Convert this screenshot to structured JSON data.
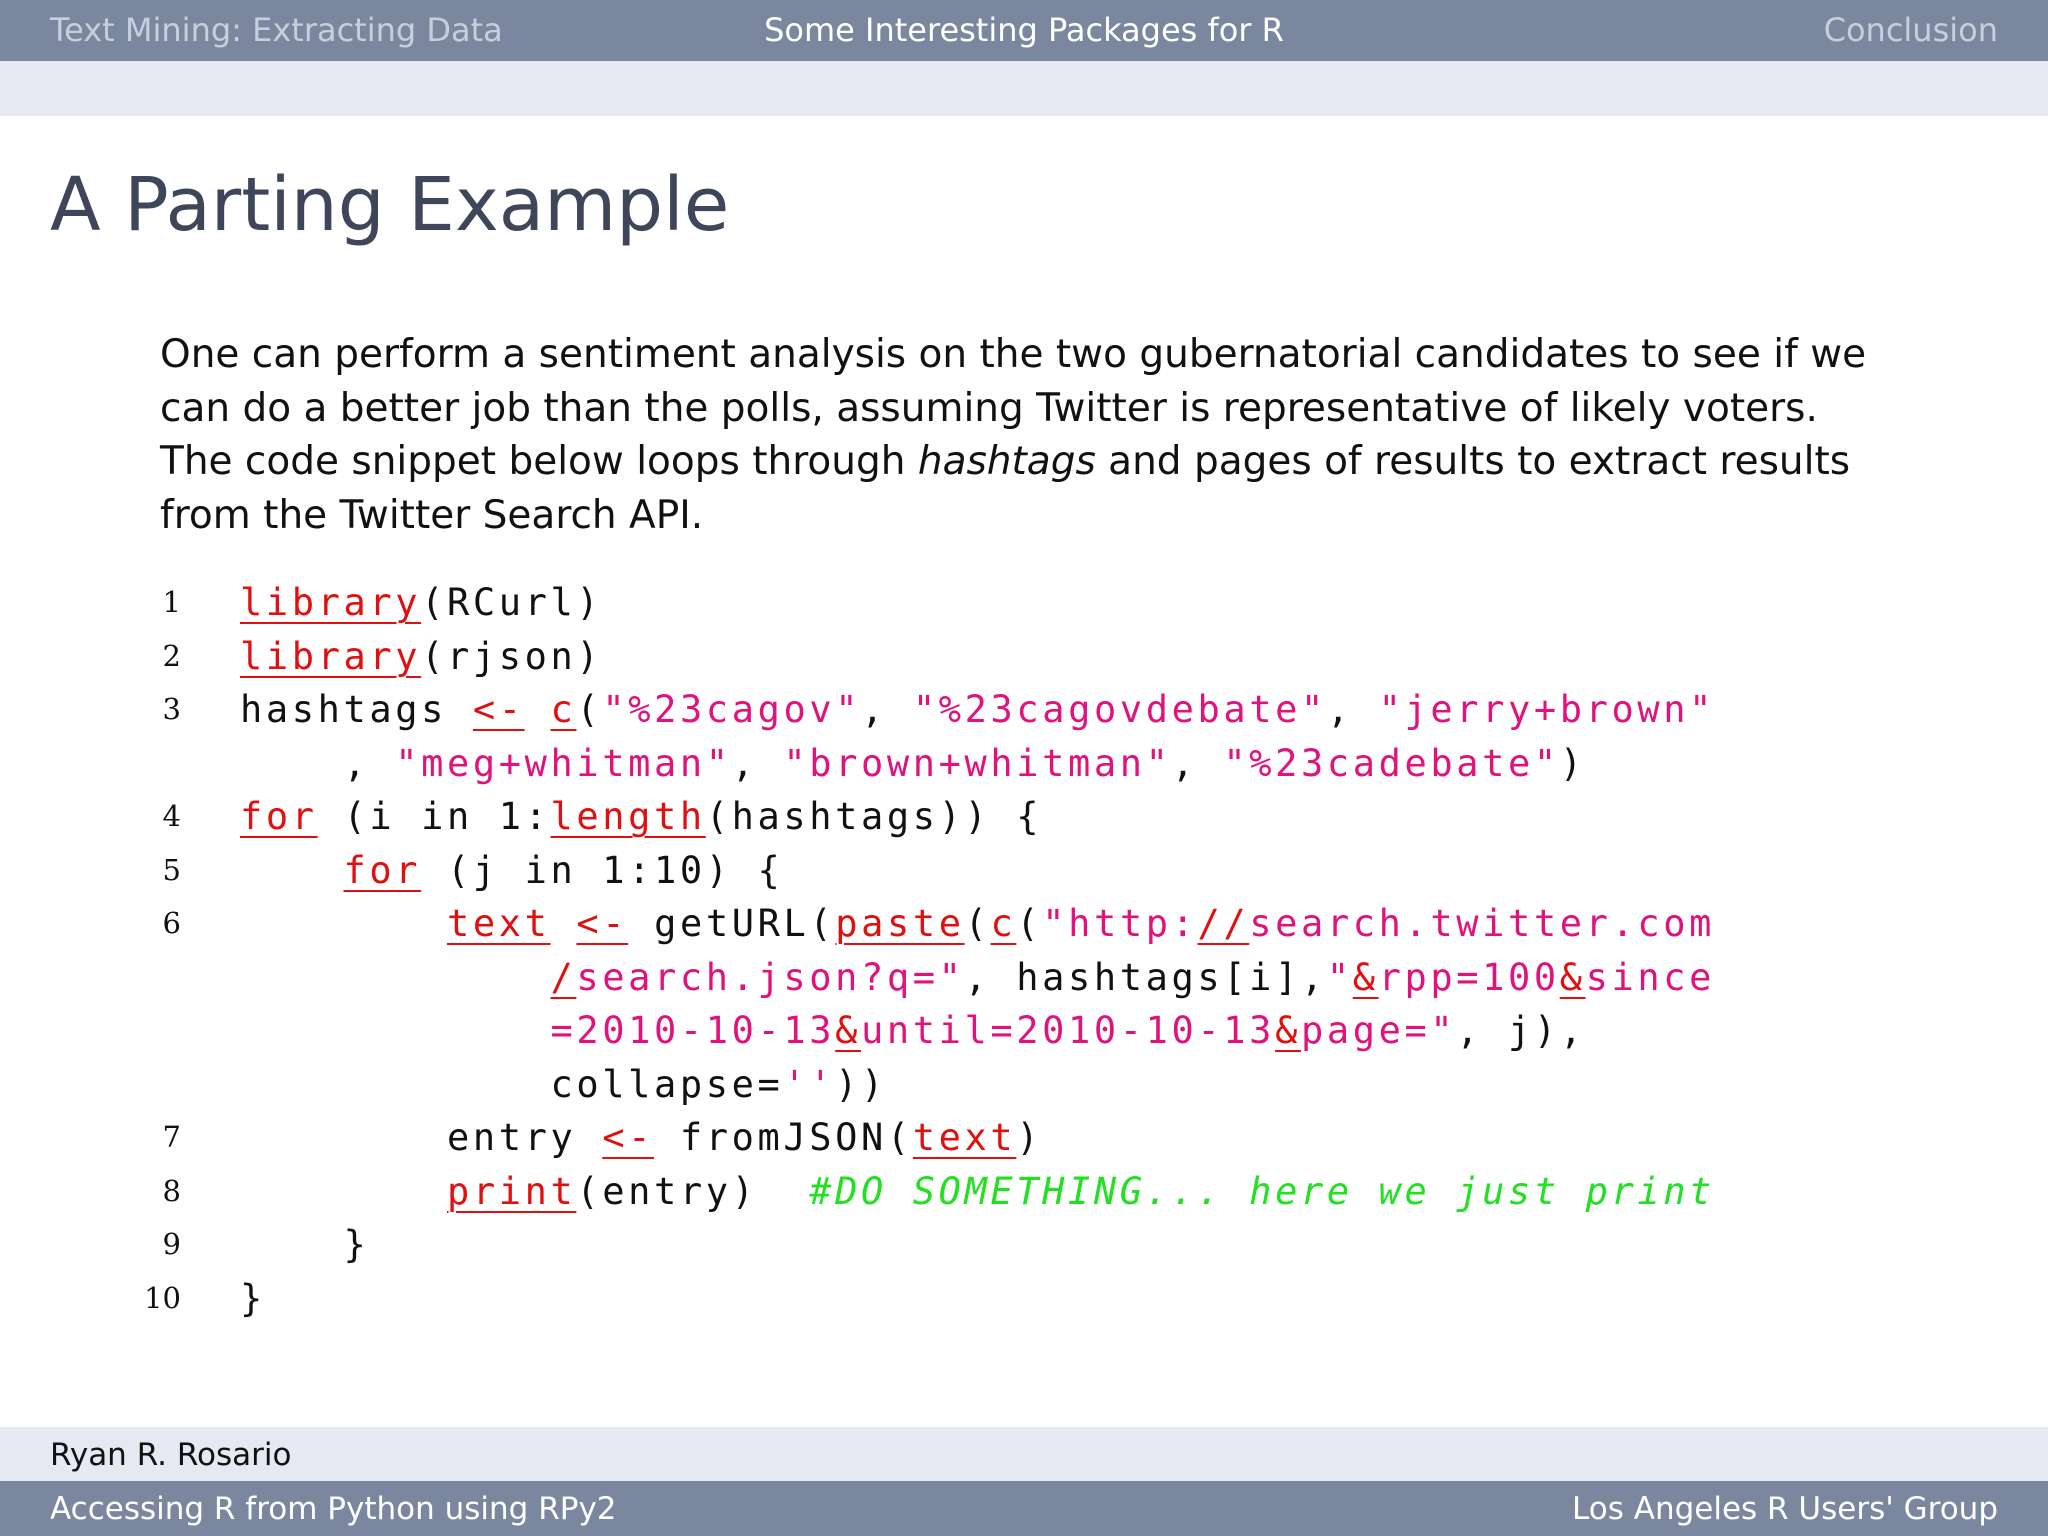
{
  "header": {
    "left": "Text Mining: Extracting Data",
    "center": "Some Interesting Packages for R",
    "right": "Conclusion"
  },
  "slide": {
    "title": "A Parting Example",
    "paragraph": {
      "before_em": "One can perform a sentiment analysis on the two gubernatorial candidates to see if we can do a better job than the polls, assuming Twitter is representative of likely voters. The code snippet below loops through ",
      "em": "hashtags",
      "after_em": " and pages of results to extract results from the Twitter Search API."
    }
  },
  "code": {
    "line_numbers": [
      "1",
      "2",
      "3",
      "4",
      "5",
      "6",
      "7",
      "8",
      "9",
      "10"
    ],
    "lines": [
      [
        {
          "t": "library",
          "k": "k"
        },
        {
          "t": "(RCurl)"
        }
      ],
      [
        {
          "t": "library",
          "k": "k"
        },
        {
          "t": "(rjson)"
        }
      ],
      [
        {
          "t": "hashtags "
        },
        {
          "t": "<-",
          "k": "k"
        },
        {
          "t": " "
        },
        {
          "t": "c",
          "k": "k"
        },
        {
          "t": "("
        },
        {
          "t": "\"%23cagov\"",
          "k": "s"
        },
        {
          "t": ", "
        },
        {
          "t": "\"%23cagovdebate\"",
          "k": "s"
        },
        {
          "t": ", "
        },
        {
          "t": "\"jerry+brown\"",
          "k": "s"
        }
      ],
      [
        {
          "t": "    , "
        },
        {
          "t": "\"meg+whitman\"",
          "k": "s"
        },
        {
          "t": ", "
        },
        {
          "t": "\"brown+whitman\"",
          "k": "s"
        },
        {
          "t": ", "
        },
        {
          "t": "\"%23cadebate\"",
          "k": "s"
        },
        {
          "t": ")"
        }
      ],
      [
        {
          "t": "for",
          "k": "k"
        },
        {
          "t": " (i in 1:"
        },
        {
          "t": "length",
          "k": "k"
        },
        {
          "t": "(hashtags)) {"
        }
      ],
      [
        {
          "t": "    "
        },
        {
          "t": "for",
          "k": "k"
        },
        {
          "t": " (j in 1:10) {"
        }
      ],
      [
        {
          "t": "        "
        },
        {
          "t": "text",
          "k": "k"
        },
        {
          "t": " "
        },
        {
          "t": "<-",
          "k": "k"
        },
        {
          "t": " getURL("
        },
        {
          "t": "paste",
          "k": "k"
        },
        {
          "t": "("
        },
        {
          "t": "c",
          "k": "k"
        },
        {
          "t": "("
        },
        {
          "t": "\"http:",
          "k": "s"
        },
        {
          "t": "//",
          "k": "k"
        },
        {
          "t": "search.twitter.com",
          "k": "s"
        }
      ],
      [
        {
          "t": "            "
        },
        {
          "t": "/",
          "k": "k"
        },
        {
          "t": "search.json?q=\"",
          "k": "s"
        },
        {
          "t": ", hashtags[i],"
        },
        {
          "t": "\"",
          "k": "s"
        },
        {
          "t": "&",
          "k": "k"
        },
        {
          "t": "rpp=100",
          "k": "s"
        },
        {
          "t": "&",
          "k": "k"
        },
        {
          "t": "since",
          "k": "s"
        }
      ],
      [
        {
          "t": "            "
        },
        {
          "t": "=2010-10-13",
          "k": "s"
        },
        {
          "t": "&",
          "k": "k"
        },
        {
          "t": "until=2010-10-13",
          "k": "s"
        },
        {
          "t": "&",
          "k": "k"
        },
        {
          "t": "page=\"",
          "k": "s"
        },
        {
          "t": ", j),"
        }
      ],
      [
        {
          "t": "            collapse="
        },
        {
          "t": "''",
          "k": "s"
        },
        {
          "t": "))"
        }
      ],
      [
        {
          "t": "        entry "
        },
        {
          "t": "<-",
          "k": "k"
        },
        {
          "t": " fromJSON("
        },
        {
          "t": "text",
          "k": "k"
        },
        {
          "t": ")"
        }
      ],
      [
        {
          "t": "        "
        },
        {
          "t": "print",
          "k": "k"
        },
        {
          "t": "(entry)  "
        },
        {
          "t": "#DO SOMETHING... here we just print",
          "k": "c"
        }
      ],
      [
        {
          "t": "    }"
        }
      ],
      [
        {
          "t": "}"
        }
      ]
    ]
  },
  "footer": {
    "author": "Ryan R. Rosario",
    "talk_title": "Accessing R from Python using RPy2",
    "venue": "Los Angeles R Users' Group"
  }
}
